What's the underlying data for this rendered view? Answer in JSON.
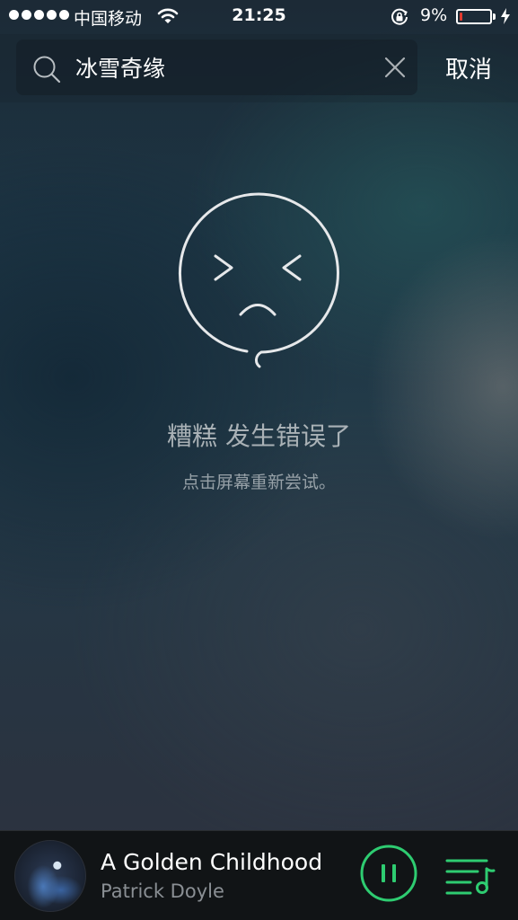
{
  "status_bar": {
    "carrier": "中国移动",
    "time": "21:25",
    "battery_percent": "9%",
    "battery_level": 0.09,
    "battery_color": "#e23b2f",
    "icons": [
      "signal-dots-icon",
      "wifi-icon",
      "rotation-lock-icon",
      "battery-icon",
      "charging-bolt-icon"
    ]
  },
  "search": {
    "query": "冰雪奇缘",
    "cancel_label": "取消",
    "icons": [
      "search-icon",
      "clear-icon"
    ]
  },
  "error": {
    "title": "糟糕 发生错误了",
    "subtitle": "点击屏幕重新尝试。",
    "icon": "sad-face-icon"
  },
  "now_playing": {
    "title": "A Golden Childhood",
    "artist": "Patrick Doyle",
    "accent_color": "#2ecc71",
    "icons": [
      "album-art",
      "pause-icon",
      "playlist-icon"
    ]
  }
}
